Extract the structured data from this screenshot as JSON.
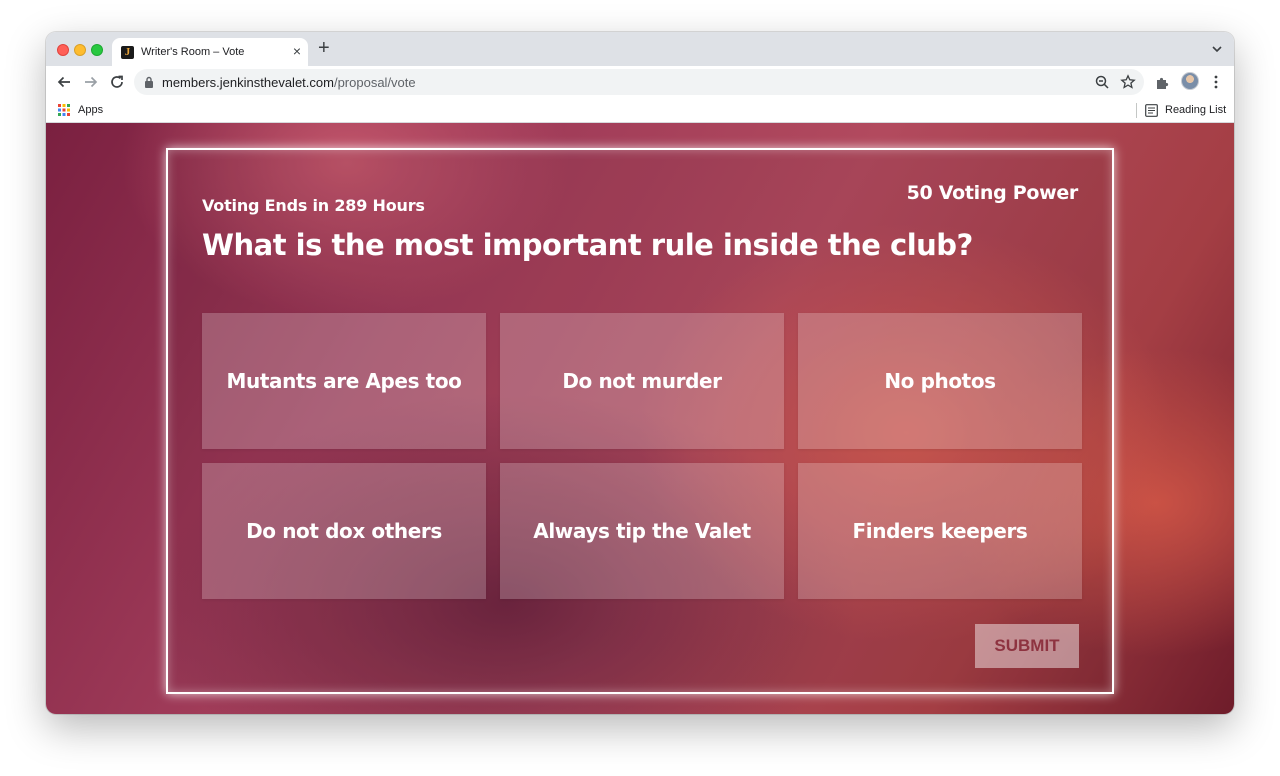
{
  "browser": {
    "tab": {
      "title": "Writer's Room – Vote",
      "favicon_letter": "J",
      "close_icon": "×"
    },
    "new_tab_icon": "+",
    "url": {
      "domain": "members.jenkinsthevalet.com",
      "path": "/proposal/vote"
    },
    "bookmarks": {
      "apps_label": "Apps",
      "reading_list_label": "Reading List"
    }
  },
  "vote": {
    "ends_label": "Voting Ends in 289 Hours",
    "voting_power": "50 Voting Power",
    "question": "What is the most important rule inside the club?",
    "options": [
      "Mutants are Apes too",
      "Do not murder",
      "No photos",
      "Do not dox others",
      "Always tip the Valet",
      "Finders keepers"
    ],
    "submit_label": "SUBMIT"
  },
  "colors": {
    "submit_text": "#8e3340",
    "panel_border": "#ffffff",
    "background_primary": "#b24a5e"
  }
}
